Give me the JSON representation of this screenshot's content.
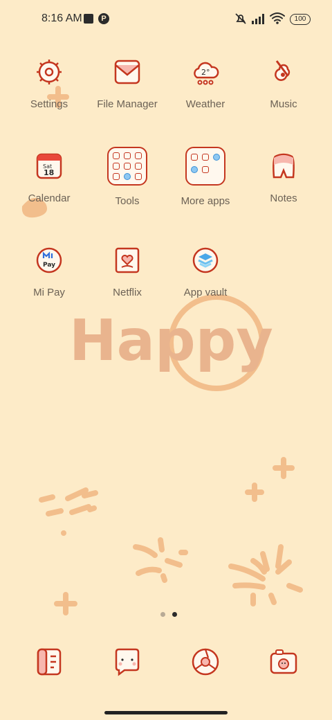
{
  "colors": {
    "background": "#FDEBC8",
    "icon_red": "#C4361F",
    "label": "#6B6155",
    "deco": "#F2BE8C"
  },
  "status_bar": {
    "time": "8:16 AM",
    "battery": "100"
  },
  "apps": [
    {
      "label": "Settings",
      "icon": "settings-icon"
    },
    {
      "label": "File Manager",
      "icon": "envelope-icon"
    },
    {
      "label": "Weather",
      "icon": "weather-cloud-icon",
      "temp": "2°"
    },
    {
      "label": "Music",
      "icon": "guitar-icon"
    },
    {
      "label": "Calendar",
      "icon": "calendar-icon",
      "day": "Sat",
      "date": "18"
    },
    {
      "label": "Tools",
      "icon": "folder-icon"
    },
    {
      "label": "More apps",
      "icon": "folder-icon"
    },
    {
      "label": "Notes",
      "icon": "tooth-icon"
    },
    {
      "label": "Mi Pay",
      "icon": "mi-pay-icon",
      "text": "Pay"
    },
    {
      "label": "Netflix",
      "icon": "heart-frame-icon"
    },
    {
      "label": "App vault",
      "icon": "app-vault-icon"
    }
  ],
  "wallpaper": {
    "text": "Happy"
  },
  "pager": {
    "pages": 2,
    "active": 2
  },
  "dock": [
    {
      "icon": "phone-icon"
    },
    {
      "icon": "messages-icon"
    },
    {
      "icon": "browser-icon"
    },
    {
      "icon": "camera-icon"
    }
  ]
}
